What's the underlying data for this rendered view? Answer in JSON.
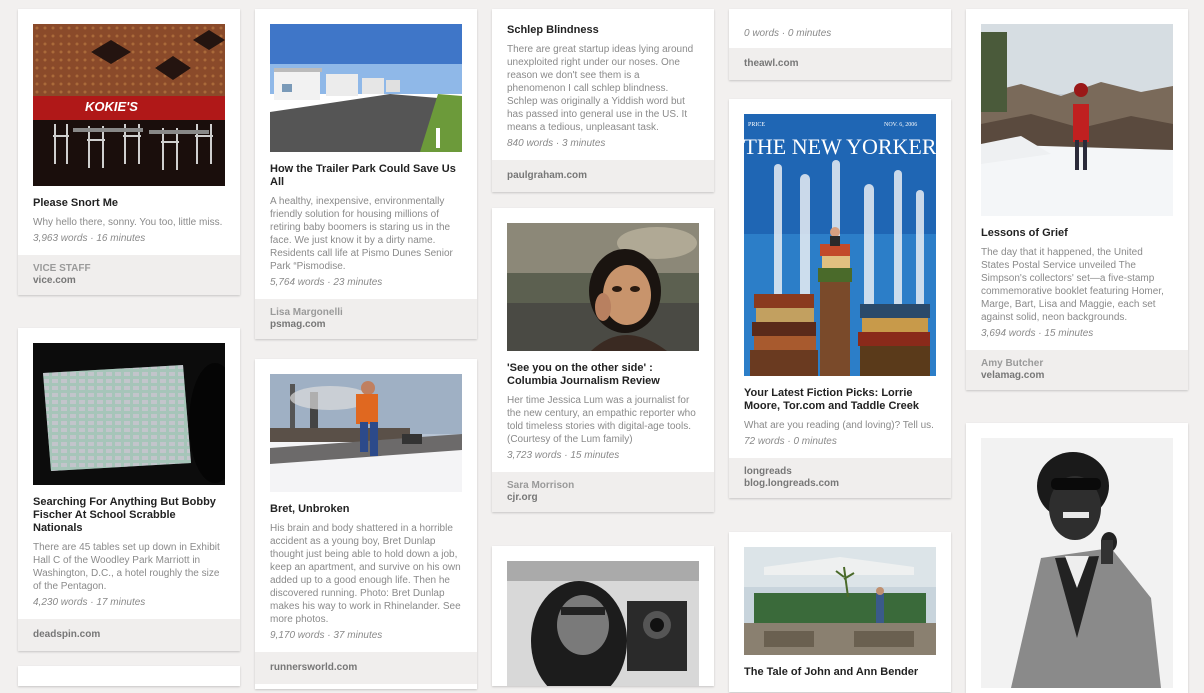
{
  "cards": [
    {
      "title": "Please Snort Me",
      "description": "Why hello there, sonny. You too, little miss.",
      "meta": "3,963 words · 16 minutes",
      "author": "VICE STAFF",
      "source": "vice.com",
      "image_text": "KOKIE'S"
    },
    {
      "title": "Searching For Anything But Bobby Fischer At School Scrabble Nationals",
      "description": "There are 45 tables set up down in Exhibit Hall C of the Woodley Park Marriott in Washington, D.C., a hotel roughly the size of the Pentagon.",
      "meta": "4,230 words · 17 minutes",
      "author": "",
      "source": "deadspin.com"
    },
    {
      "title": "How the Trailer Park Could Save Us All",
      "description": "A healthy, inexpensive, environmentally friendly solution for housing millions of retiring baby boomers is staring us in the face. We just know it by a dirty name. Residents call life at Pismo Dunes Senior Park “Pismodise.",
      "meta": "5,764 words · 23 minutes",
      "author": "Lisa Margonelli",
      "source": "psmag.com"
    },
    {
      "title": "Bret, Unbroken",
      "description": "His brain and body shattered in a horrible accident as a young boy, Bret Dunlap thought just being able to hold down a job, keep an apartment, and survive on his own added up to a good enough life. Then he discovered running. Photo: Bret Dunlap makes his way to work in Rhinelander. See more photos.",
      "meta": "9,170 words · 37 minutes",
      "author": "",
      "source": "runnersworld.com"
    },
    {
      "title": "Schlep Blindness",
      "description": "There are great startup ideas lying around unexploited right under our noses. One reason we don't see them is a phenomenon I call schlep blindness. Schlep was originally a Yiddish word but has passed into general use in the US. It means a tedious, unpleasant task.",
      "meta": "840 words · 3 minutes",
      "author": "",
      "source": "paulgraham.com"
    },
    {
      "title": "'See you on the other side' : Columbia Journalism Review",
      "description": "Her time Jessica Lum was a journalist for the new century, an empathic reporter who told timeless stories with digital-age tools. (Courtesy of the Lum family)",
      "meta": "3,723 words · 15 minutes",
      "author": "Sara Morrison",
      "source": "cjr.org"
    },
    {
      "title": "",
      "description": "",
      "meta": "0 words · 0 minutes",
      "author": "",
      "source": "theawl.com"
    },
    {
      "title": "Your Latest Fiction Picks: Lorrie Moore, Tor.com and Taddle Creek",
      "description": "What are you reading (and loving)? Tell us.",
      "meta": "72 words · 0 minutes",
      "author": "longreads",
      "source": "blog.longreads.com",
      "image_text": {
        "price": "PRICE",
        "masthead": "THE NEW YORKER",
        "date": "NOV. 6, 2006"
      }
    },
    {
      "title": "The Tale of John and Ann Bender",
      "description": "",
      "meta": "",
      "author": "",
      "source": ""
    },
    {
      "title": "Lessons of Grief",
      "description": "The day that it happened, the United States Postal Service unveiled The Simpson's collectors' set—a five-stamp commemorative booklet featuring Homer, Marge, Bart, Lisa and Maggie, each set against solid, neon backgrounds.",
      "meta": "3,694 words · 15 minutes",
      "author": "Amy Butcher",
      "source": "velamag.com"
    }
  ]
}
